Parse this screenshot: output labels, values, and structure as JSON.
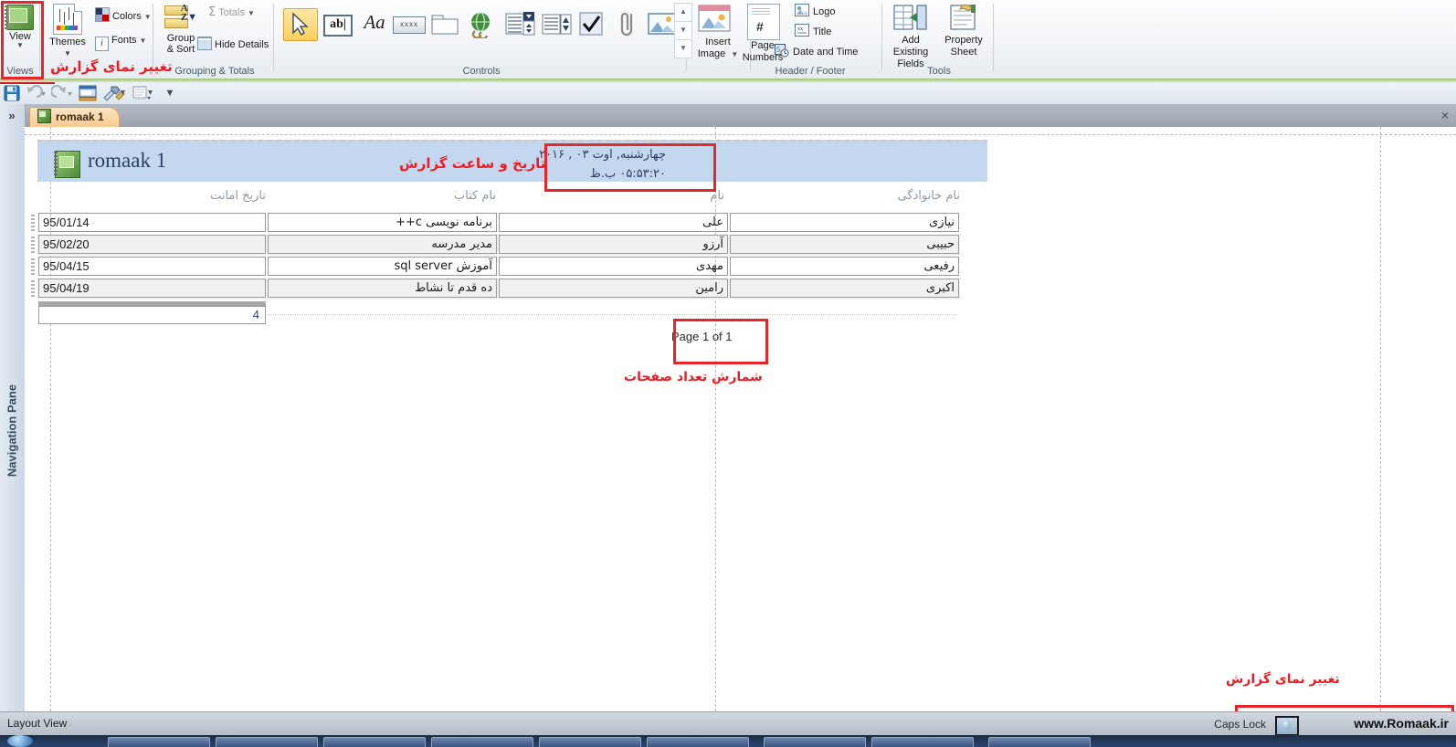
{
  "ribbon": {
    "groups": [
      {
        "name": "views",
        "label": "Views"
      },
      {
        "name": "themes",
        "label": ""
      },
      {
        "name": "grouping",
        "label": "Grouping & Totals"
      },
      {
        "name": "controls",
        "label": "Controls"
      },
      {
        "name": "header_footer",
        "label": "Header / Footer"
      },
      {
        "name": "tools",
        "label": "Tools"
      }
    ],
    "views": {
      "button_label": "View",
      "group_label": "Views"
    },
    "themes": {
      "themes_label": "Themes",
      "colors_label": "Colors",
      "fonts_label": "Fonts",
      "fonts_icon_char": "i"
    },
    "grouping": {
      "group_sort_label_line1": "Group",
      "group_sort_label_line2": "& Sort",
      "totals_label": "Totals",
      "totals_symbol": "Σ",
      "hide_details_label": "Hide Details",
      "group_label": "Grouping & Totals"
    },
    "controls": {
      "group_label": "Controls",
      "items": [
        {
          "name": "select-tool",
          "icon": "arrow-pointer-icon",
          "selected": true
        },
        {
          "name": "text-box-control",
          "icon": "text-box-icon",
          "glyph": "ab|"
        },
        {
          "name": "label-control",
          "icon": "label-aa-icon",
          "glyph": "Aa"
        },
        {
          "name": "button-control",
          "icon": "button-icon",
          "glyph": "xxxx"
        },
        {
          "name": "tab-control",
          "icon": "tab-folder-icon"
        },
        {
          "name": "hyperlink-control",
          "icon": "globe-hyperlink-icon"
        },
        {
          "name": "combo-box-control",
          "icon": "combo-box-icon"
        },
        {
          "name": "list-box-control",
          "icon": "list-box-icon"
        },
        {
          "name": "check-box-control",
          "icon": "check-box-icon"
        },
        {
          "name": "attachment-control",
          "icon": "paperclip-icon"
        },
        {
          "name": "image-control",
          "icon": "image-icon"
        }
      ]
    },
    "insert_image": {
      "label_line1": "Insert",
      "label_line2": "Image"
    },
    "header_footer": {
      "page_numbers_line1": "Page",
      "page_numbers_line2": "Numbers",
      "logo_label": "Logo",
      "title_label": "Title",
      "date_time_label": "Date and Time",
      "group_label": "Header / Footer"
    },
    "tools": {
      "add_existing_fields_line1": "Add Existing",
      "add_existing_fields_line2": "Fields",
      "property_sheet_line1": "Property",
      "property_sheet_line2": "Sheet",
      "group_label": "Tools"
    }
  },
  "quick_access": {
    "items": [
      {
        "name": "save-button",
        "icon": "floppy-save-icon"
      },
      {
        "name": "undo-button",
        "icon": "undo-arrow-icon"
      },
      {
        "name": "redo-button",
        "icon": "redo-arrow-icon"
      },
      {
        "name": "view-switch-button",
        "icon": "view-window-icon"
      },
      {
        "name": "tools-button",
        "icon": "hammer-wrench-icon"
      },
      {
        "name": "print-preview-button",
        "icon": "print-preview-icon"
      },
      {
        "name": "customize-qat-button",
        "icon": "chevron-down-icon"
      }
    ]
  },
  "document_tab": {
    "label": "romaak 1",
    "icon": "report-notebook-icon",
    "close_label": "×"
  },
  "navigation_pane": {
    "title": "Navigation Pane",
    "expand_icon": "»"
  },
  "report": {
    "title": "romaak 1",
    "title_icon": "report-notebook-icon",
    "date_line": "چهارشنبه, اوت ۰۳ , ۲۰۱۶",
    "time_line": "۰۵:۵۳:۲۰ ب.ظ",
    "columns": [
      {
        "name": "tarikh-amanat",
        "label": "تاریخ امانت",
        "dir": "rtl"
      },
      {
        "name": "nam-ketab",
        "label": "نام کتاب",
        "dir": "rtl"
      },
      {
        "name": "nam",
        "label": "نام",
        "dir": "rtl"
      },
      {
        "name": "nam-khanevadegi",
        "label": "نام خانوادگی",
        "dir": "rtl"
      }
    ],
    "rows": [
      {
        "date": "95/01/14",
        "book": "برنامه نویسی c++",
        "first": "علی",
        "last": "نیازی"
      },
      {
        "date": "95/02/20",
        "book": "مدیر مدرسه",
        "first": "آرزو",
        "last": "حبیبی"
      },
      {
        "date": "95/04/15",
        "book": "آموزش sql server",
        "first": "مهدی",
        "last": "رفیعی"
      },
      {
        "date": "95/04/19",
        "book": "ده قدم تا نشاط",
        "first": "رامین",
        "last": "اکبری"
      }
    ],
    "total_value": "4",
    "page_footer": "Page 1 of 1"
  },
  "annotations": [
    {
      "name": "annotation-change-report-view-top",
      "text": "تغییر نمای گزارش"
    },
    {
      "name": "annotation-date-time-report",
      "text": "تاریخ و ساعت گزارش"
    },
    {
      "name": "annotation-page-count",
      "text": "شمارش تعداد صفحات"
    },
    {
      "name": "annotation-change-report-view-bottom",
      "text": "تغییر نمای گزارش"
    }
  ],
  "status_bar": {
    "view_mode": "Layout View",
    "caps_lock": "Caps Lock",
    "site": "www.Romaak.ir",
    "site_icon": "globe-icon"
  },
  "colors": {
    "accent_red": "#ea1d24",
    "header_band": "#c3d8ef",
    "tab_orange": "#f8c98f",
    "ribbon_green": "#9ec27a",
    "title_blue": "#2a3f66"
  }
}
